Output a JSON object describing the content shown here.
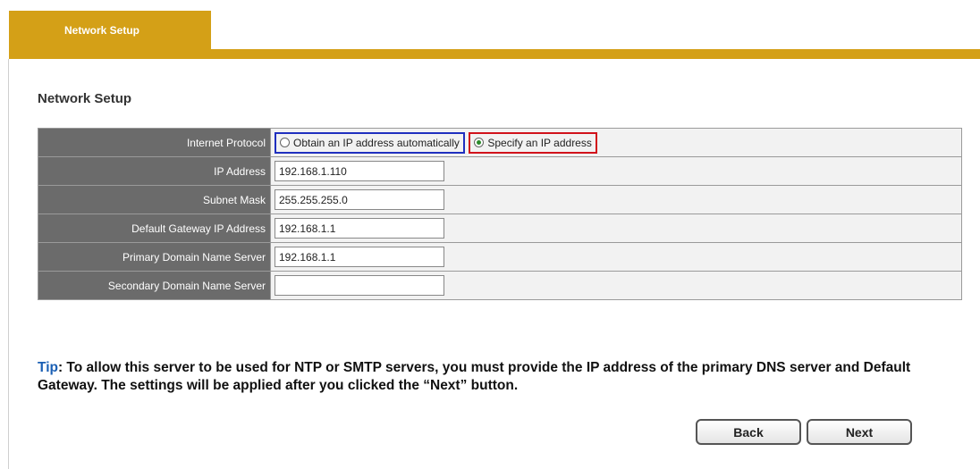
{
  "tab": {
    "label": "Network Setup"
  },
  "section_title": "Network Setup",
  "form": {
    "internet_protocol": {
      "label": "Internet Protocol",
      "option_auto": "Obtain an IP address automatically",
      "option_manual": "Specify an IP address",
      "selected": "manual"
    },
    "ip_address": {
      "label": "IP Address",
      "value": "192.168.1.110"
    },
    "subnet_mask": {
      "label": "Subnet Mask",
      "value": "255.255.255.0"
    },
    "default_gateway": {
      "label": "Default Gateway IP Address",
      "value": "192.168.1.1"
    },
    "primary_dns": {
      "label": "Primary Domain Name Server",
      "value": "192.168.1.1"
    },
    "secondary_dns": {
      "label": "Secondary Domain Name Server",
      "value": ""
    }
  },
  "tip": {
    "label": "Tip",
    "text": ": To allow this server to be used for NTP or SMTP servers, you must provide the IP address of the primary DNS server and Default Gateway. The settings will be applied after you clicked the “Next” button."
  },
  "buttons": {
    "back": "Back",
    "next": "Next"
  },
  "colors": {
    "accent": "#d4a017",
    "label_bg": "#6b6b6b",
    "tip_label": "#1a5fb4",
    "radio_auto_outline": "#1f2fbf",
    "radio_manual_outline": "#d1121b"
  }
}
